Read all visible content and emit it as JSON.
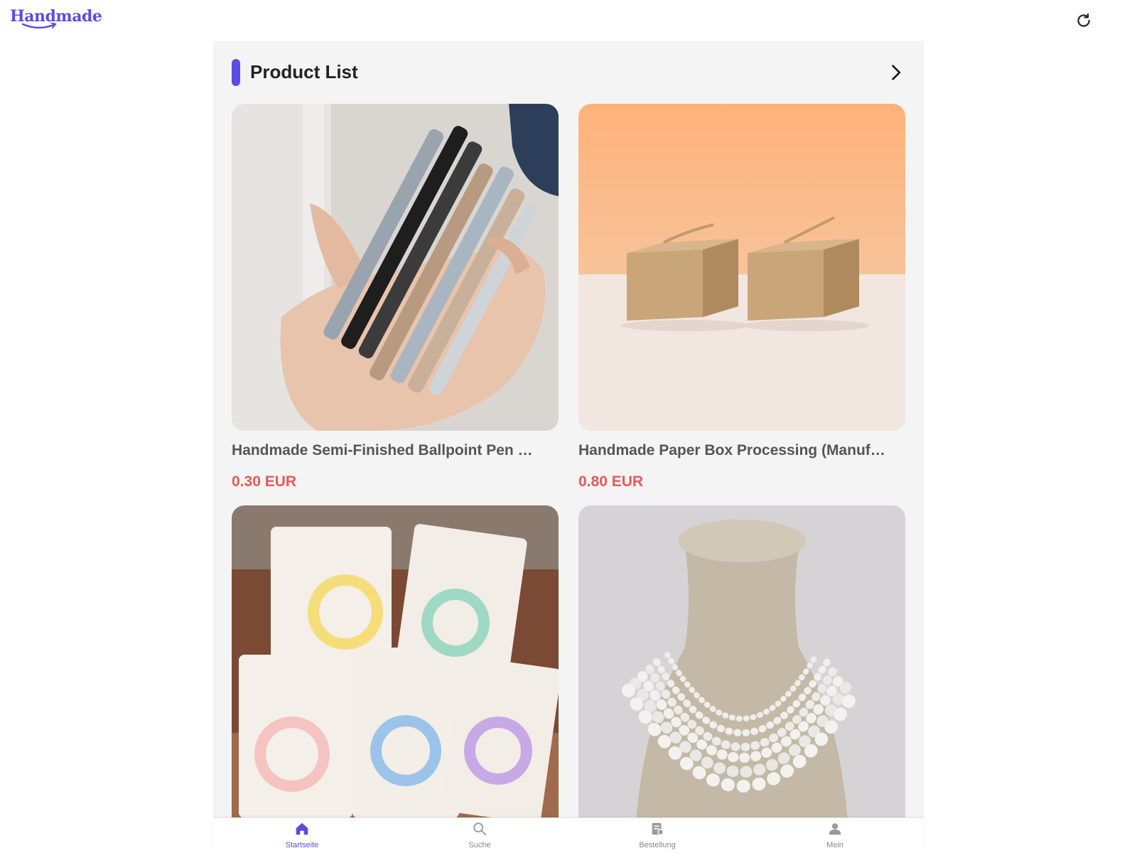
{
  "header": {
    "logo_text": "Handmade"
  },
  "section": {
    "title": "Product List"
  },
  "products": [
    {
      "name": "Handmade Semi-Finished Ballpoint Pen …",
      "price": "0.30 EUR"
    },
    {
      "name": "Handmade Paper Box Processing (Manuf…",
      "price": "0.80 EUR"
    },
    {
      "name": "",
      "price": ""
    },
    {
      "name": "",
      "price": ""
    }
  ],
  "nav": {
    "items": [
      {
        "label": "Startseite",
        "icon": "home-icon",
        "active": true
      },
      {
        "label": "Suche",
        "icon": "search-icon",
        "active": false
      },
      {
        "label": "Bestellung",
        "icon": "order-icon",
        "active": false
      },
      {
        "label": "Mein",
        "icon": "user-icon",
        "active": false
      }
    ]
  },
  "colors": {
    "accent": "#5b4ce6",
    "price": "#e85a5a",
    "background": "#f4f4f4"
  }
}
